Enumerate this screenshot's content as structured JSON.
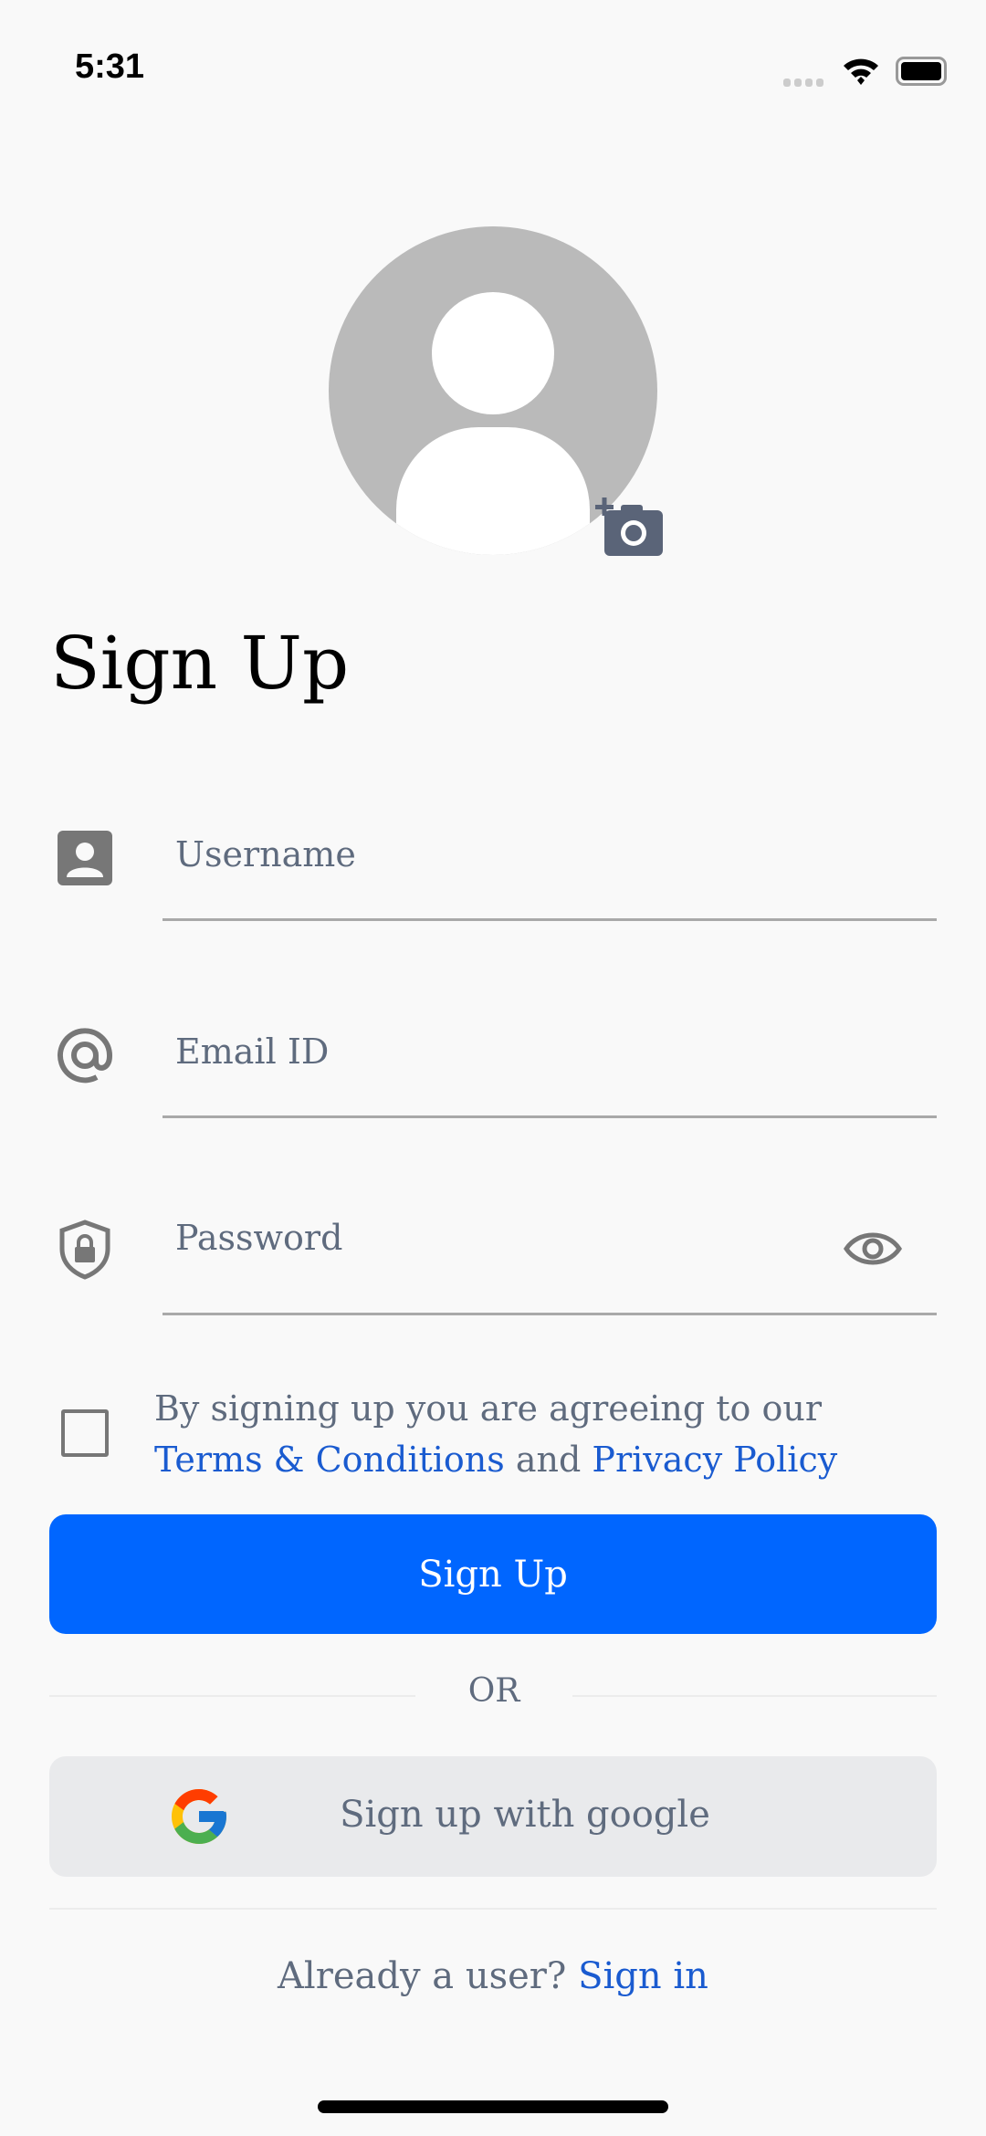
{
  "status_bar": {
    "time": "5:31"
  },
  "avatar": {
    "add_photo_icon": "camera-plus-icon"
  },
  "page": {
    "title": "Sign Up"
  },
  "form": {
    "username": {
      "placeholder": "Username",
      "icon": "user-card-icon"
    },
    "email": {
      "placeholder": "Email ID",
      "icon": "at-icon"
    },
    "password": {
      "placeholder": "Password",
      "icon": "shield-lock-icon",
      "toggle_icon": "eye-icon"
    }
  },
  "terms": {
    "text": "By signing up you are agreeing to our",
    "terms_link": "Terms & Conditions",
    "and": "and",
    "privacy_link": "Privacy Policy",
    "checked": false
  },
  "buttons": {
    "sign_up": "Sign Up",
    "or": "OR",
    "google": "Sign up with google"
  },
  "footer": {
    "prompt": "Already a user?",
    "sign_in": "Sign in"
  },
  "colors": {
    "primary": "#0066ff",
    "link": "#1a5bd0",
    "text_muted": "#5f6b7e",
    "background": "#f9f9f9"
  }
}
